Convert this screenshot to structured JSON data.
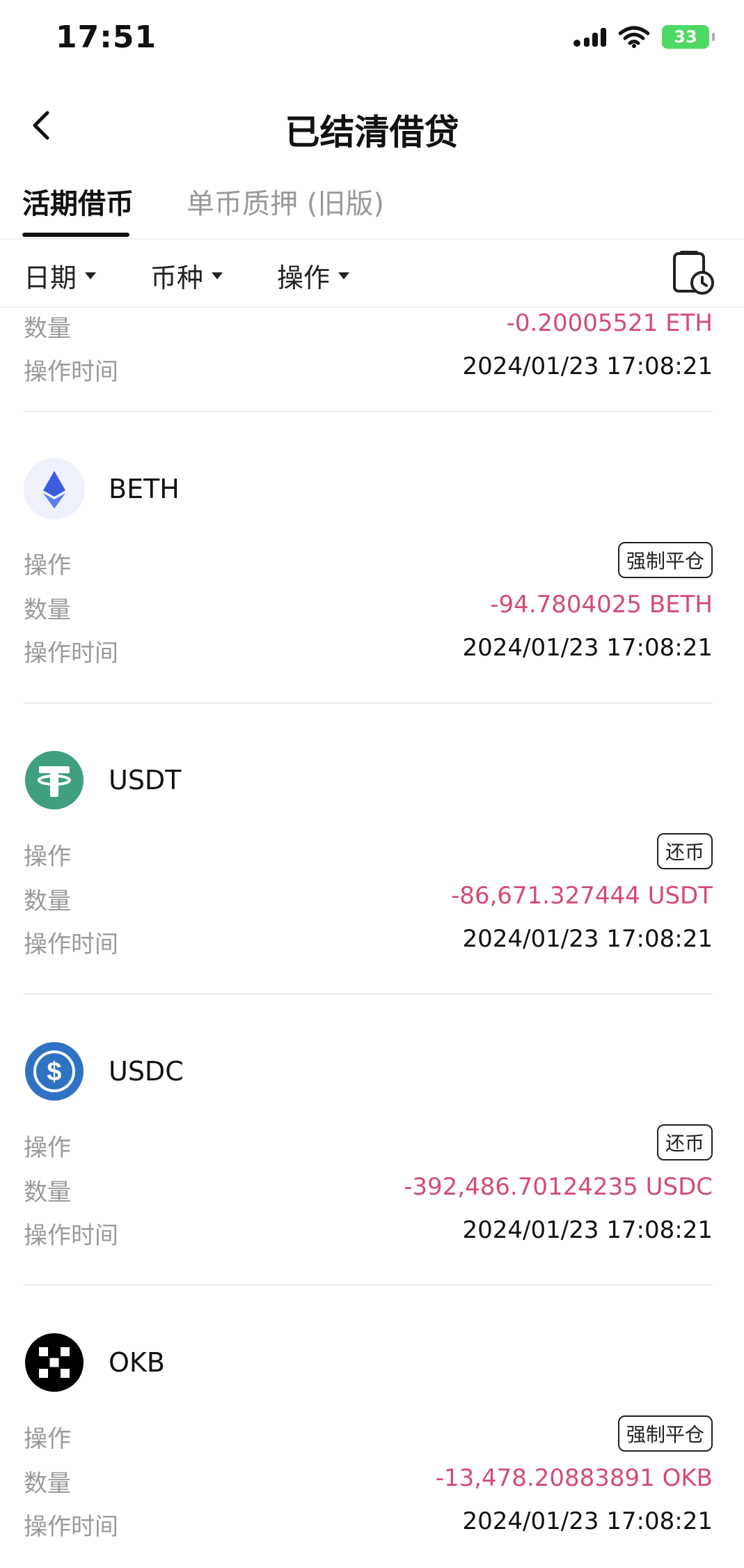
{
  "status_bar": {
    "time": "17:51",
    "battery": "33"
  },
  "nav": {
    "title": "已结清借贷"
  },
  "tabs": [
    {
      "label": "活期借币",
      "active": true
    },
    {
      "label": "单币质押 (旧版)",
      "active": false
    }
  ],
  "filters": [
    {
      "label": "日期"
    },
    {
      "label": "币种"
    },
    {
      "label": "操作"
    }
  ],
  "field_labels": {
    "operation": "操作",
    "amount": "数量",
    "time": "操作时间"
  },
  "partial_record": {
    "amount": "-0.20005521 ETH",
    "time": "2024/01/23 17:08:21"
  },
  "records": [
    {
      "coin": "BETH",
      "icon": "eth-icon",
      "operation": "强制平仓",
      "amount": "-94.7804025 BETH",
      "time": "2024/01/23 17:08:21"
    },
    {
      "coin": "USDT",
      "icon": "tether-icon",
      "operation": "还币",
      "amount": "-86,671.327444 USDT",
      "time": "2024/01/23 17:08:21"
    },
    {
      "coin": "USDC",
      "icon": "usdc-icon",
      "operation": "还币",
      "amount": "-392,486.70124235 USDC",
      "time": "2024/01/23 17:08:21"
    },
    {
      "coin": "OKB",
      "icon": "okb-icon",
      "operation": "强制平仓",
      "amount": "-13,478.20883891 OKB",
      "time": "2024/01/23 17:08:21"
    }
  ],
  "colors": {
    "negative": "#d44c73",
    "usdt": "#3f9f7f",
    "usdc": "#2f72c4",
    "eth_bg": "#eef0fa",
    "eth": "#3b5ee0"
  }
}
